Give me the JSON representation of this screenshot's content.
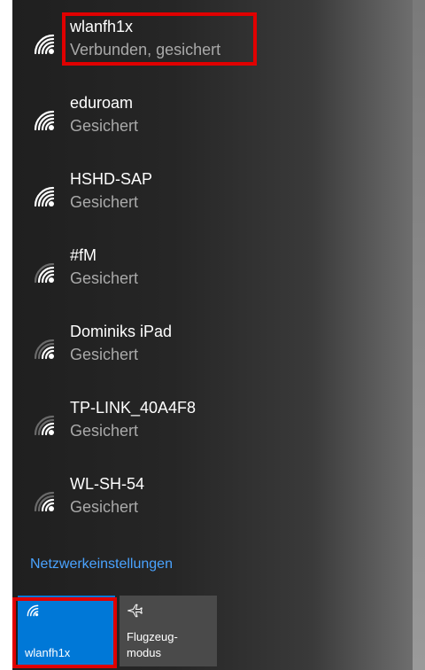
{
  "networks": [
    {
      "name": "wlanfh1x",
      "status": "Verbunden, gesichert",
      "wifi_icon": "wifi-icon"
    },
    {
      "name": "eduroam",
      "status": "Gesichert",
      "wifi_icon": "wifi-icon"
    },
    {
      "name": "HSHD-SAP",
      "status": "Gesichert",
      "wifi_icon": "wifi-icon"
    },
    {
      "name": "#fM",
      "status": "Gesichert",
      "wifi_icon": "wifi-icon"
    },
    {
      "name": "Dominiks iPad",
      "status": "Gesichert",
      "wifi_icon": "wifi-icon"
    },
    {
      "name": "TP-LINK_40A4F8",
      "status": "Gesichert",
      "wifi_icon": "wifi-icon"
    },
    {
      "name": "WL-SH-54",
      "status": "Gesichert",
      "wifi_icon": "wifi-icon"
    }
  ],
  "settings_link": "Netzwerkeinstellungen",
  "quick_actions": {
    "wifi_tile_label": "wlanfh1x",
    "airplane_tile_label": "Flugzeug-\nmodus",
    "wifi_icon": "wifi-icon",
    "airplane_icon": "airplane-icon"
  },
  "colors": {
    "accent": "#0078d7",
    "link": "#4aa3ff",
    "highlight": "#e00000"
  }
}
